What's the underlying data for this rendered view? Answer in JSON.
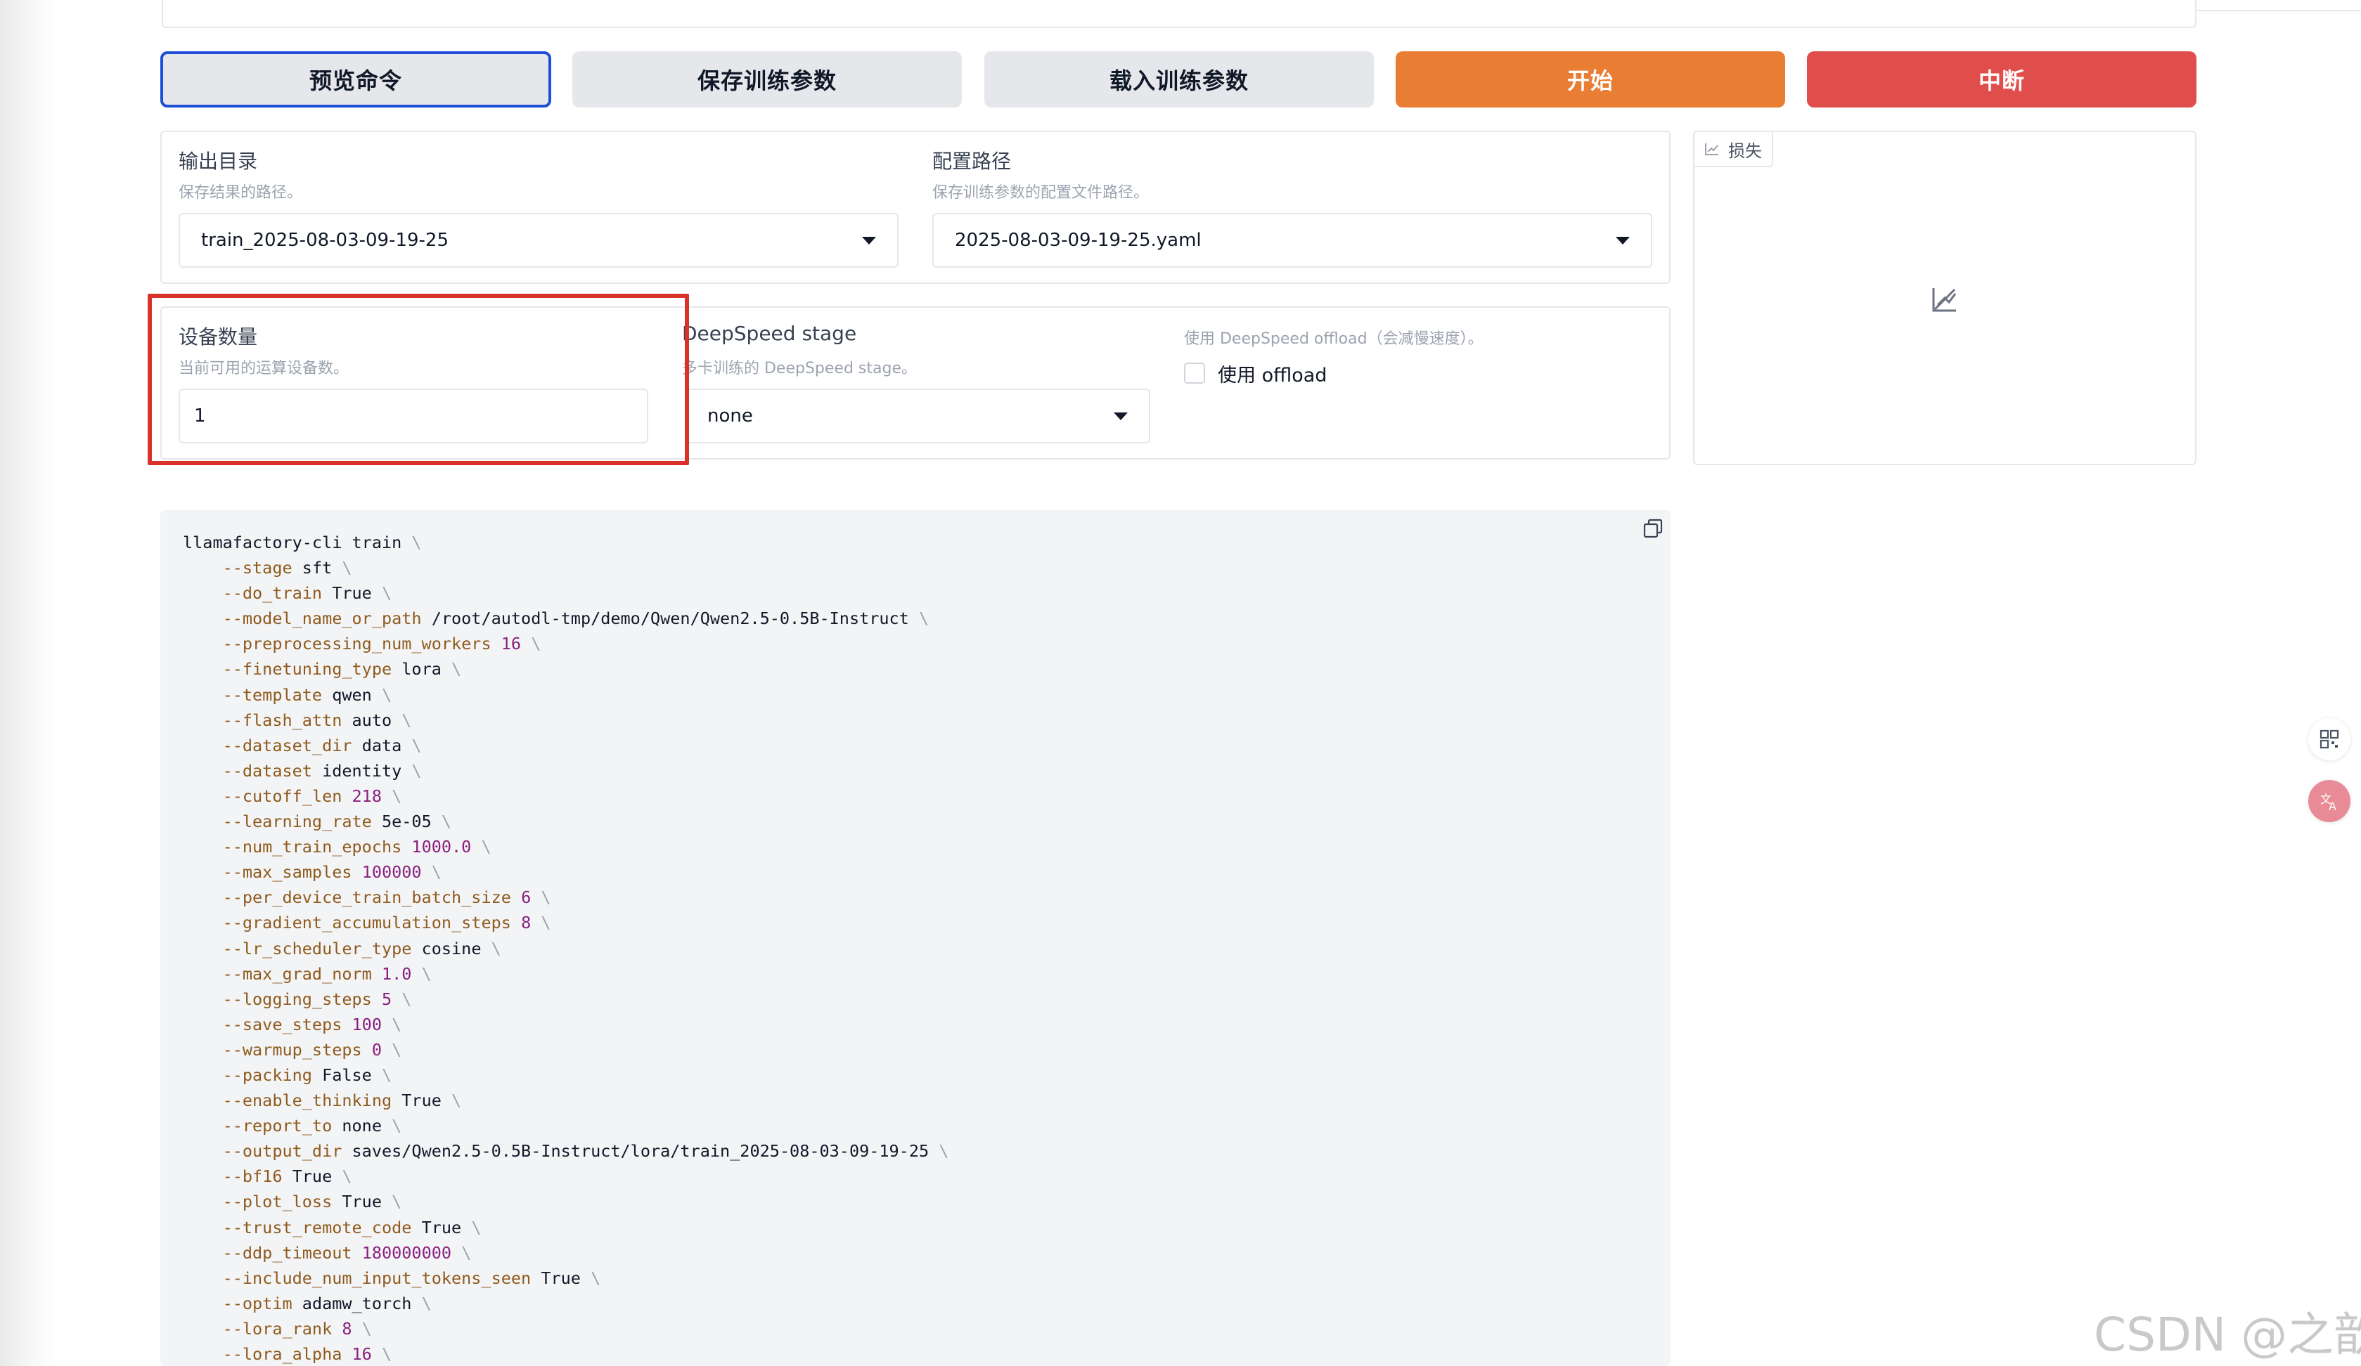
{
  "actions": {
    "preview": "预览命令",
    "save": "保存训练参数",
    "load": "载入训练参数",
    "start": "开始",
    "stop": "中断"
  },
  "output": {
    "label": "输出目录",
    "info": "保存结果的路径。",
    "value": "train_2025-08-03-09-19-25"
  },
  "config": {
    "label": "配置路径",
    "info": "保存训练参数的配置文件路径。",
    "value": "2025-08-03-09-19-25.yaml"
  },
  "devices": {
    "label": "设备数量",
    "info": "当前可用的运算设备数。",
    "value": "1"
  },
  "deepspeed": {
    "label": "DeepSpeed stage",
    "info": "多卡训练的 DeepSpeed stage。",
    "value": "none"
  },
  "offload": {
    "info": "使用 DeepSpeed offload（会减慢速度）。",
    "label": "使用 offload",
    "checked": false
  },
  "plot": {
    "tab_label": "损失",
    "icon": "chart-icon"
  },
  "command": {
    "head": "llamafactory-cli train",
    "args": [
      {
        "flag": "--stage",
        "value": "sft",
        "kind": "text"
      },
      {
        "flag": "--do_train",
        "value": "True",
        "kind": "text"
      },
      {
        "flag": "--model_name_or_path",
        "value": "/root/autodl-tmp/demo/Qwen/Qwen2.5-0.5B-Instruct",
        "kind": "text"
      },
      {
        "flag": "--preprocessing_num_workers",
        "value": "16",
        "kind": "num"
      },
      {
        "flag": "--finetuning_type",
        "value": "lora",
        "kind": "text"
      },
      {
        "flag": "--template",
        "value": "qwen",
        "kind": "text"
      },
      {
        "flag": "--flash_attn",
        "value": "auto",
        "kind": "text"
      },
      {
        "flag": "--dataset_dir",
        "value": "data",
        "kind": "text"
      },
      {
        "flag": "--dataset",
        "value": "identity",
        "kind": "text"
      },
      {
        "flag": "--cutoff_len",
        "value": "218",
        "kind": "num"
      },
      {
        "flag": "--learning_rate",
        "value": "5e-05",
        "kind": "text"
      },
      {
        "flag": "--num_train_epochs",
        "value": "1000.0",
        "kind": "num"
      },
      {
        "flag": "--max_samples",
        "value": "100000",
        "kind": "num"
      },
      {
        "flag": "--per_device_train_batch_size",
        "value": "6",
        "kind": "num"
      },
      {
        "flag": "--gradient_accumulation_steps",
        "value": "8",
        "kind": "num"
      },
      {
        "flag": "--lr_scheduler_type",
        "value": "cosine",
        "kind": "text"
      },
      {
        "flag": "--max_grad_norm",
        "value": "1.0",
        "kind": "num"
      },
      {
        "flag": "--logging_steps",
        "value": "5",
        "kind": "num"
      },
      {
        "flag": "--save_steps",
        "value": "100",
        "kind": "num"
      },
      {
        "flag": "--warmup_steps",
        "value": "0",
        "kind": "num"
      },
      {
        "flag": "--packing",
        "value": "False",
        "kind": "text"
      },
      {
        "flag": "--enable_thinking",
        "value": "True",
        "kind": "text"
      },
      {
        "flag": "--report_to",
        "value": "none",
        "kind": "text"
      },
      {
        "flag": "--output_dir",
        "value": "saves/Qwen2.5-0.5B-Instruct/lora/train_2025-08-03-09-19-25",
        "kind": "text"
      },
      {
        "flag": "--bf16",
        "value": "True",
        "kind": "text"
      },
      {
        "flag": "--plot_loss",
        "value": "True",
        "kind": "text"
      },
      {
        "flag": "--trust_remote_code",
        "value": "True",
        "kind": "text"
      },
      {
        "flag": "--ddp_timeout",
        "value": "180000000",
        "kind": "num"
      },
      {
        "flag": "--include_num_input_tokens_seen",
        "value": "True",
        "kind": "text"
      },
      {
        "flag": "--optim",
        "value": "adamw_torch",
        "kind": "text"
      },
      {
        "flag": "--lora_rank",
        "value": "8",
        "kind": "num"
      },
      {
        "flag": "--lora_alpha",
        "value": "16",
        "kind": "num"
      }
    ]
  },
  "floating": {
    "qr_icon": "qr-code-icon",
    "translate_icon": "translate-icon"
  },
  "watermark": "CSDN @之歆",
  "colors": {
    "start": "#ea7d34",
    "stop": "#e04e4b",
    "highlight": "#d9322a",
    "focus": "#1d4ed8"
  }
}
